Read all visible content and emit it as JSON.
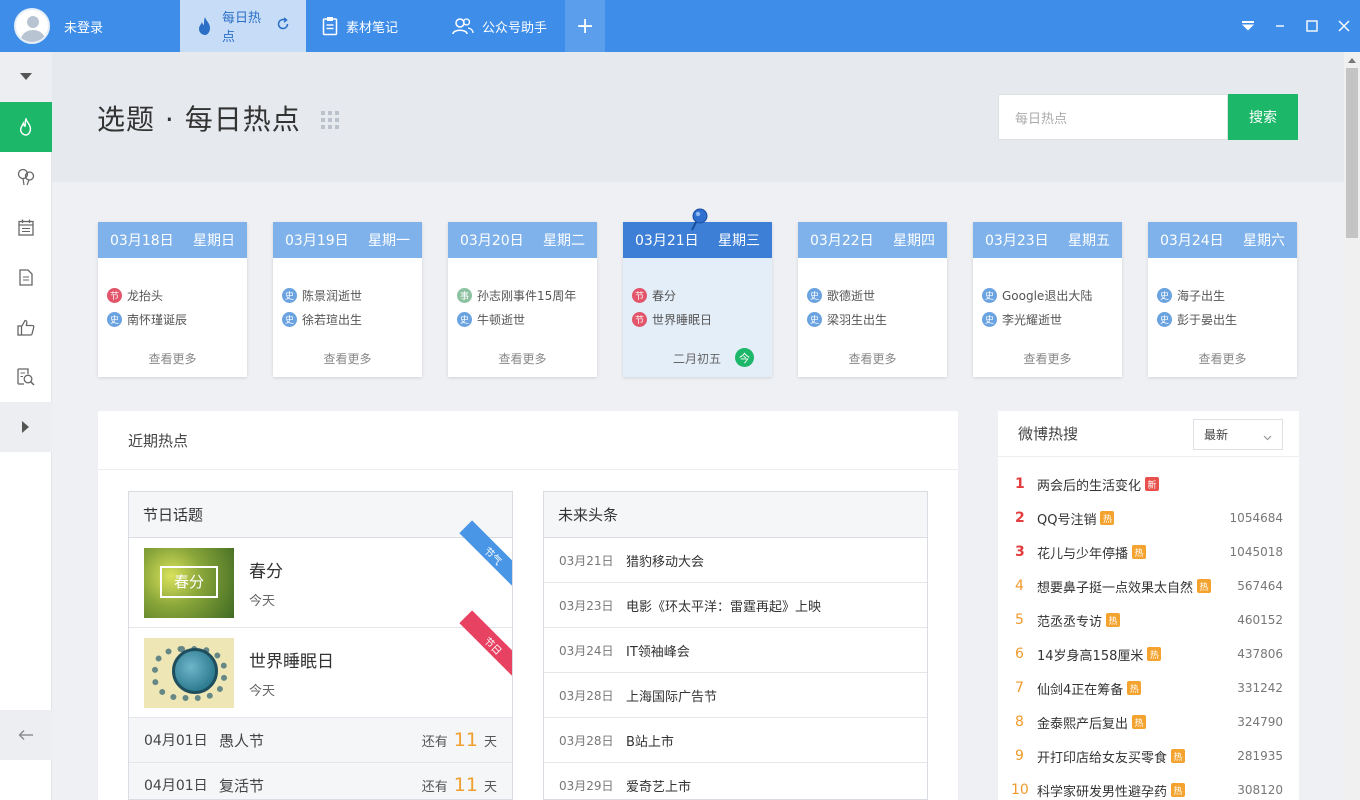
{
  "topbar": {
    "user": "未登录",
    "tabs": [
      {
        "label": "每日热点"
      },
      {
        "label": "素材笔记"
      },
      {
        "label": "公众号助手"
      }
    ],
    "add": "+"
  },
  "header": {
    "title": "选题 · 每日热点",
    "search_placeholder": "每日热点",
    "search_button": "搜索"
  },
  "calendar": [
    {
      "date": "03月18日",
      "weekday": "星期日",
      "items": [
        {
          "badge": "节",
          "text": "龙抬头"
        },
        {
          "badge": "史",
          "text": "南怀瑾诞辰"
        }
      ],
      "more": "查看更多"
    },
    {
      "date": "03月19日",
      "weekday": "星期一",
      "items": [
        {
          "badge": "史",
          "text": "陈景润逝世"
        },
        {
          "badge": "史",
          "text": "徐若瑄出生"
        }
      ],
      "more": "查看更多"
    },
    {
      "date": "03月20日",
      "weekday": "星期二",
      "items": [
        {
          "badge": "事",
          "text": "孙志刚事件15周年"
        },
        {
          "badge": "史",
          "text": "牛顿逝世"
        }
      ],
      "more": "查看更多"
    },
    {
      "date": "03月21日",
      "weekday": "星期三",
      "items": [
        {
          "badge": "节",
          "text": "春分"
        },
        {
          "badge": "节",
          "text": "世界睡眠日"
        }
      ],
      "lunar": "二月初五",
      "today": "今"
    },
    {
      "date": "03月22日",
      "weekday": "星期四",
      "items": [
        {
          "badge": "史",
          "text": "歌德逝世"
        },
        {
          "badge": "史",
          "text": "梁羽生出生"
        }
      ],
      "more": "查看更多"
    },
    {
      "date": "03月23日",
      "weekday": "星期五",
      "items": [
        {
          "badge": "史",
          "text": "Google退出大陆"
        },
        {
          "badge": "史",
          "text": "李光耀逝世"
        }
      ],
      "more": "查看更多"
    },
    {
      "date": "03月24日",
      "weekday": "星期六",
      "items": [
        {
          "badge": "史",
          "text": "海子出生"
        },
        {
          "badge": "史",
          "text": "彭于晏出生"
        }
      ],
      "more": "查看更多"
    }
  ],
  "recent": {
    "title": "近期热点",
    "festival": {
      "title": "节日话题",
      "featured": [
        {
          "name": "春分",
          "sub": "今天",
          "ribbon": "节气",
          "thumb_text": "春分"
        },
        {
          "name": "世界睡眠日",
          "sub": "今天",
          "ribbon": "节日"
        }
      ],
      "rows": [
        {
          "date": "04月01日",
          "name": "愚人节",
          "pre": "还有",
          "days": "11",
          "post": "天"
        },
        {
          "date": "04月01日",
          "name": "复活节",
          "pre": "还有",
          "days": "11",
          "post": "天"
        }
      ]
    },
    "news": {
      "title": "未来头条",
      "rows": [
        {
          "date": "03月21日",
          "text": "猎豹移动大会"
        },
        {
          "date": "03月23日",
          "text": "电影《环太平洋：雷霆再起》上映"
        },
        {
          "date": "03月24日",
          "text": "IT领袖峰会"
        },
        {
          "date": "03月28日",
          "text": "上海国际广告节"
        },
        {
          "date": "03月28日",
          "text": "B站上市"
        },
        {
          "date": "03月29日",
          "text": "爱奇艺上市"
        }
      ]
    }
  },
  "weibo": {
    "title": "微博热搜",
    "filter": "最新",
    "items": [
      {
        "rank": "1",
        "title": "两会后的生活变化",
        "tag": "新",
        "count": ""
      },
      {
        "rank": "2",
        "title": "QQ号注销",
        "tag": "热",
        "count": "1054684"
      },
      {
        "rank": "3",
        "title": "花儿与少年停播",
        "tag": "热",
        "count": "1045018"
      },
      {
        "rank": "4",
        "title": "想要鼻子挺一点效果太自然",
        "tag": "热",
        "count": "567464"
      },
      {
        "rank": "5",
        "title": "范丞丞专访",
        "tag": "热",
        "count": "460152"
      },
      {
        "rank": "6",
        "title": "14岁身高158厘米",
        "tag": "热",
        "count": "437806"
      },
      {
        "rank": "7",
        "title": "仙剑4正在筹备",
        "tag": "热",
        "count": "331242"
      },
      {
        "rank": "8",
        "title": "金泰熙产后复出",
        "tag": "热",
        "count": "324790"
      },
      {
        "rank": "9",
        "title": "开打印店给女友买零食",
        "tag": "热",
        "count": "281935"
      },
      {
        "rank": "10",
        "title": "科学家研发男性避孕药",
        "tag": "热",
        "count": "308120"
      }
    ]
  }
}
